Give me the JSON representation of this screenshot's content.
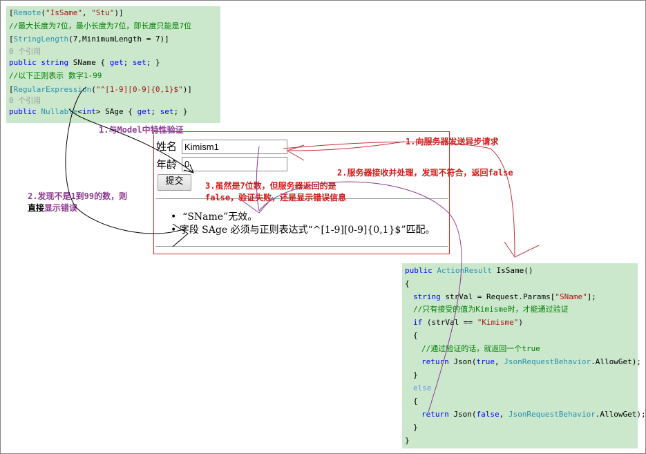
{
  "model_code": {
    "line1": {
      "open": "[",
      "attr": "Remote",
      "p1": "(",
      "s1": "\"IsSame\"",
      "comma": ", ",
      "s2": "\"Stu\"",
      "close": ")]"
    },
    "line2": "//最大长度为7位，最小长度为7位，即长度只能是7位",
    "line3": {
      "open": "[",
      "attr": "StringLength",
      "rest": "(7,MinimumLength = 7)]"
    },
    "line4": "0 个引用",
    "line5": {
      "kw1": "public",
      "kw2": "string",
      "name": " SName { ",
      "get": "get",
      "semi1": "; ",
      "set": "set",
      "end": "; }"
    },
    "line6": "//以下正则表示 数字1-99",
    "line7": {
      "open": "[",
      "attr": "RegularExpression",
      "p1": "(",
      "str": "\"^[1-9][0-9]{0,1}$\"",
      "close": ")]"
    },
    "line8": "0 个引用",
    "line9": {
      "kw1": "public",
      "type": "Nullable",
      "lt": "<",
      "kw2": "int",
      "name": "> SAge { ",
      "get": "get",
      "semi1": "; ",
      "set": "set",
      "end": "; }"
    }
  },
  "form": {
    "name_label": "姓名",
    "name_value": "Kimism1",
    "age_label": "年龄",
    "age_value": "0",
    "submit_label": "提交",
    "errors": [
      "“SName”无效。",
      "字段 SAge 必须与正则表达式“^[1-9][0-9]{0,1}$”匹配。"
    ]
  },
  "controller_code": {
    "l1": {
      "kw": "public",
      "type": "ActionResult",
      "name": " IsSame()"
    },
    "l2": "{",
    "l3": {
      "kw": "string",
      "rest": " strVal = Request.Params[",
      "str": "\"SName\"",
      "end": "];"
    },
    "l4": "//只有接受的值为Kimisme时，才能通过验证",
    "l5": {
      "kw": "if",
      "rest": " (strVal == ",
      "str": "\"Kimisme\"",
      "end": ")"
    },
    "l6": "{",
    "l7": "//通过验证的话，就返回一个true",
    "l8": {
      "kw": "return",
      "mid": " Json(",
      "kw2": "true",
      "comma": ", ",
      "type": "JsonRequestBehavior",
      "end": ".AllowGet);"
    },
    "l9": "}",
    "l10": "else",
    "l11": "{",
    "l12": {
      "kw": "return",
      "mid": " Json(",
      "kw2": "false",
      "comma": ", ",
      "type": "JsonRequestBehavior",
      "end": ".AllowGet);"
    },
    "l13": "}",
    "l14": "}"
  },
  "annotations": {
    "a1": "1.与Model中特性验证",
    "a2_line1": "2.发现不是1到99的数，则",
    "a2_line2_black": "直接",
    "a2_line2_purple": "显示错误",
    "a3": "1.向服务器发送异步请求",
    "a4": "2.服务器接收并处理，发现不符合，返回false",
    "a5_line1": "3.虽然是7位数，但服务器返回的是",
    "a5_line2": "false，验证失败，还是显示错误信息"
  },
  "colors": {
    "code_bg": "#cbe8cd",
    "keyword": "#0000ff",
    "type": "#2b91af",
    "string": "#a31515",
    "comment": "#008000",
    "annotation_purple": "#8b3a8f",
    "annotation_red": "#d21818",
    "form_border": "#d12a2a"
  }
}
